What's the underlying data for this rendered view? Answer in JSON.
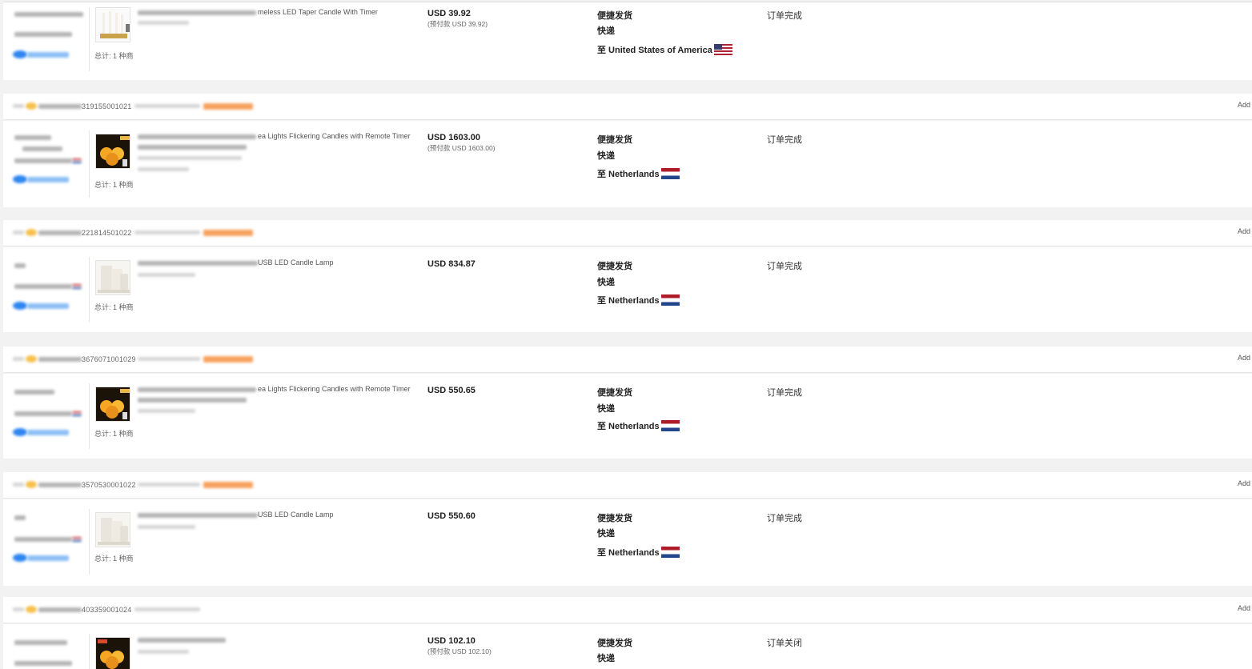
{
  "orders": [
    {
      "order_no": "",
      "product_title": "meless LED Taper Candle With Timer",
      "total_label": "总计: 1 种商",
      "price": "USD 39.92",
      "prepay": "(预付款 USD 39.92)",
      "ship_line1": "便捷发货",
      "ship_line2": "快递",
      "destination": "至 United States of America",
      "flag": "us-flag-icon",
      "status": "订单完成",
      "image": "taper-candles"
    },
    {
      "order_no": "319155001021",
      "product_title": "ea Lights Flickering Candles with Remote Timer",
      "total_label": "总计: 1 种商",
      "price": "USD 1603.00",
      "prepay": "(预付款 USD 1603.00)",
      "ship_line1": "便捷发货",
      "ship_line2": "快递",
      "destination": "至 Netherlands",
      "flag": "nl-flag-icon",
      "status": "订单完成",
      "image": "flicker-candles"
    },
    {
      "order_no": "221814501022",
      "product_title": "USB LED Candle Lamp",
      "total_label": "总计: 1 种商",
      "price": "USD 834.87",
      "prepay": "",
      "ship_line1": "便捷发货",
      "ship_line2": "快递",
      "destination": "至 Netherlands",
      "flag": "nl-flag-icon",
      "status": "订单完成",
      "image": "white-candles"
    },
    {
      "order_no": "3676071001029",
      "product_title": "ea Lights Flickering Candles with Remote Timer",
      "total_label": "总计: 1 种商",
      "price": "USD 550.65",
      "prepay": "",
      "ship_line1": "便捷发货",
      "ship_line2": "快递",
      "destination": "至 Netherlands",
      "flag": "nl-flag-icon",
      "status": "订单完成",
      "image": "flicker-candles"
    },
    {
      "order_no": "3570530001022",
      "product_title": "USB LED Candle Lamp",
      "total_label": "总计: 1 种商",
      "price": "USD 550.60",
      "prepay": "",
      "ship_line1": "便捷发货",
      "ship_line2": "快递",
      "destination": "至 Netherlands",
      "flag": "nl-flag-icon",
      "status": "订单完成",
      "image": "white-candles"
    },
    {
      "order_no": "403359001024",
      "product_title": "",
      "total_label": "",
      "price": "USD 102.10",
      "prepay": "(预付款 USD 102.10)",
      "ship_line1": "便捷发货",
      "ship_line2": "快递",
      "destination": "",
      "flag": "",
      "status": "订单关闭",
      "image": "flicker-candles"
    }
  ],
  "header_cut_label": "Add"
}
